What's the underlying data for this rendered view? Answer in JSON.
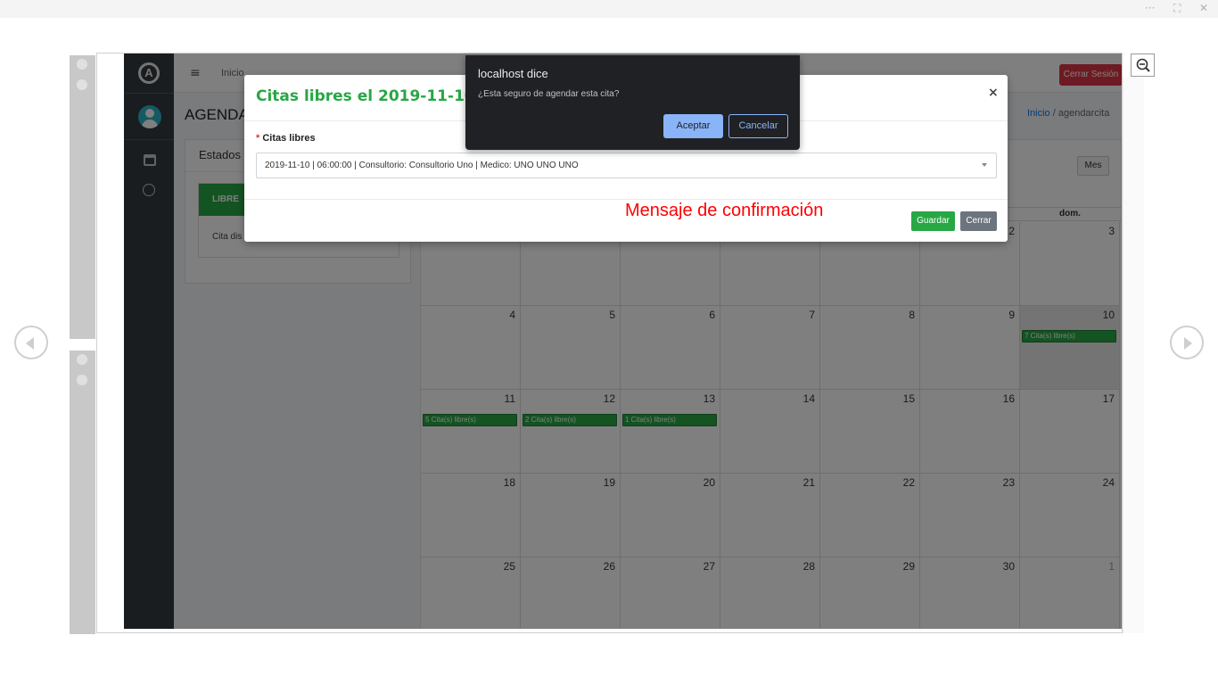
{
  "viewer": {
    "more_glyph": "···",
    "fit_glyph": "⛶",
    "close_glyph": "✕"
  },
  "sidebar": {
    "logo_letter": "A"
  },
  "topbar": {
    "menu_glyph": "≡",
    "home_label": "Inicio",
    "logout_label": "Cerrar Sesión"
  },
  "page": {
    "title": "AGENDAR",
    "breadcrumb_home": "Inicio",
    "breadcrumb_sep": " / ",
    "breadcrumb_current": "agendarcita"
  },
  "estados": {
    "title": "Estados",
    "libre_label": "LIBRE",
    "libre_desc": "Cita dis"
  },
  "calendar": {
    "view_button": "Mes",
    "last_day_header": "dom.",
    "weeks": [
      [
        {
          "d": "",
          "ev": ""
        },
        {
          "d": "",
          "ev": ""
        },
        {
          "d": "",
          "ev": ""
        },
        {
          "d": "",
          "ev": ""
        },
        {
          "d": "",
          "ev": ""
        },
        {
          "d": "2",
          "ev": ""
        },
        {
          "d": "3",
          "ev": ""
        }
      ],
      [
        {
          "d": "4",
          "ev": ""
        },
        {
          "d": "5",
          "ev": ""
        },
        {
          "d": "6",
          "ev": ""
        },
        {
          "d": "7",
          "ev": ""
        },
        {
          "d": "8",
          "ev": ""
        },
        {
          "d": "9",
          "ev": ""
        },
        {
          "d": "10",
          "ev": "7 Cita(s) libre(s)",
          "today": true
        }
      ],
      [
        {
          "d": "11",
          "ev": "5 Cita(s) libre(s)"
        },
        {
          "d": "12",
          "ev": "2 Cita(s) libre(s)"
        },
        {
          "d": "13",
          "ev": "1 Cita(s) libre(s)"
        },
        {
          "d": "14",
          "ev": ""
        },
        {
          "d": "15",
          "ev": ""
        },
        {
          "d": "16",
          "ev": ""
        },
        {
          "d": "17",
          "ev": ""
        }
      ],
      [
        {
          "d": "18",
          "ev": ""
        },
        {
          "d": "19",
          "ev": ""
        },
        {
          "d": "20",
          "ev": ""
        },
        {
          "d": "21",
          "ev": ""
        },
        {
          "d": "22",
          "ev": ""
        },
        {
          "d": "23",
          "ev": ""
        },
        {
          "d": "24",
          "ev": ""
        }
      ],
      [
        {
          "d": "25",
          "ev": ""
        },
        {
          "d": "26",
          "ev": ""
        },
        {
          "d": "27",
          "ev": ""
        },
        {
          "d": "28",
          "ev": ""
        },
        {
          "d": "29",
          "ev": ""
        },
        {
          "d": "30",
          "ev": ""
        },
        {
          "d": "1",
          "ev": "",
          "other": true
        }
      ]
    ]
  },
  "modal": {
    "title": "Citas libres el 2019-11-10",
    "close_glyph": "×",
    "field_required_mark": "*",
    "field_label": "Citas libres",
    "selected_option": "2019-11-10 | 06:00:00 | Consultorio: Consultorio Uno | Medico: UNO UNO UNO",
    "annotation": "Mensaje de confirmación",
    "save_label": "Guardar",
    "close_label": "Cerrar"
  },
  "dialog": {
    "title": "localhost dice",
    "message": "¿Esta seguro de agendar esta cita?",
    "ok_label": "Aceptar",
    "cancel_label": "Cancelar"
  },
  "colors": {
    "success": "#28a745",
    "danger": "#dc3545",
    "sidebar": "#343a40",
    "dialog_bg": "#202124",
    "dialog_accent": "#8ab4f8",
    "annotation": "#ff0000"
  }
}
